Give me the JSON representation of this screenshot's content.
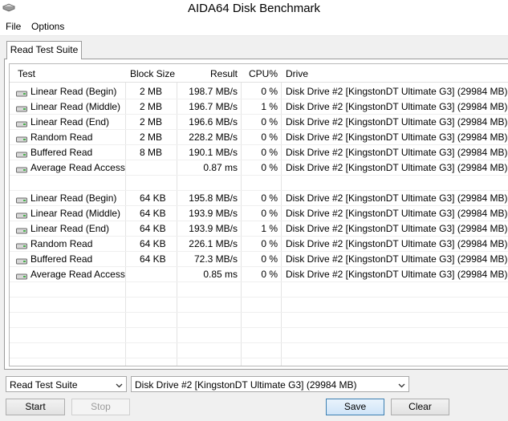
{
  "window": {
    "title": "AIDA64 Disk Benchmark"
  },
  "menu": {
    "file": "File",
    "options": "Options"
  },
  "tab": {
    "label": "Read Test Suite"
  },
  "columns": {
    "test": "Test",
    "block": "Block Size",
    "result": "Result",
    "cpu": "CPU%",
    "drive": "Drive"
  },
  "rows": [
    {
      "test": "Linear Read (Begin)",
      "block": "2 MB",
      "result": "198.7 MB/s",
      "cpu": "0 %",
      "drive": "Disk Drive #2  [KingstonDT Ultimate G3]  (29984 MB)"
    },
    {
      "test": "Linear Read (Middle)",
      "block": "2 MB",
      "result": "196.7 MB/s",
      "cpu": "1 %",
      "drive": "Disk Drive #2  [KingstonDT Ultimate G3]  (29984 MB)"
    },
    {
      "test": "Linear Read (End)",
      "block": "2 MB",
      "result": "196.6 MB/s",
      "cpu": "0 %",
      "drive": "Disk Drive #2  [KingstonDT Ultimate G3]  (29984 MB)"
    },
    {
      "test": "Random Read",
      "block": "2 MB",
      "result": "228.2 MB/s",
      "cpu": "0 %",
      "drive": "Disk Drive #2  [KingstonDT Ultimate G3]  (29984 MB)"
    },
    {
      "test": "Buffered Read",
      "block": "8 MB",
      "result": "190.1 MB/s",
      "cpu": "0 %",
      "drive": "Disk Drive #2  [KingstonDT Ultimate G3]  (29984 MB)"
    },
    {
      "test": "Average Read Access",
      "block": "",
      "result": "0.87 ms",
      "cpu": "0 %",
      "drive": "Disk Drive #2  [KingstonDT Ultimate G3]  (29984 MB)"
    },
    {
      "test": "",
      "block": "",
      "result": "",
      "cpu": "",
      "drive": ""
    },
    {
      "test": "Linear Read (Begin)",
      "block": "64 KB",
      "result": "195.8 MB/s",
      "cpu": "0 %",
      "drive": "Disk Drive #2  [KingstonDT Ultimate G3]  (29984 MB)"
    },
    {
      "test": "Linear Read (Middle)",
      "block": "64 KB",
      "result": "193.9 MB/s",
      "cpu": "0 %",
      "drive": "Disk Drive #2  [KingstonDT Ultimate G3]  (29984 MB)"
    },
    {
      "test": "Linear Read (End)",
      "block": "64 KB",
      "result": "193.9 MB/s",
      "cpu": "1 %",
      "drive": "Disk Drive #2  [KingstonDT Ultimate G3]  (29984 MB)"
    },
    {
      "test": "Random Read",
      "block": "64 KB",
      "result": "226.1 MB/s",
      "cpu": "0 %",
      "drive": "Disk Drive #2  [KingstonDT Ultimate G3]  (29984 MB)"
    },
    {
      "test": "Buffered Read",
      "block": "64 KB",
      "result": "72.3 MB/s",
      "cpu": "0 %",
      "drive": "Disk Drive #2  [KingstonDT Ultimate G3]  (29984 MB)"
    },
    {
      "test": "Average Read Access",
      "block": "",
      "result": "0.85 ms",
      "cpu": "0 %",
      "drive": "Disk Drive #2  [KingstonDT Ultimate G3]  (29984 MB)"
    }
  ],
  "controls": {
    "suite_select": "Read Test Suite",
    "drive_select": "Disk Drive #2  [KingstonDT Ultimate G3]  (29984 MB)",
    "start": "Start",
    "stop": "Stop",
    "save": "Save",
    "clear": "Clear"
  },
  "icons": {
    "app": "disk-benchmark-icon",
    "row": "drive-icon",
    "dropdown": "chevron-down-icon"
  }
}
